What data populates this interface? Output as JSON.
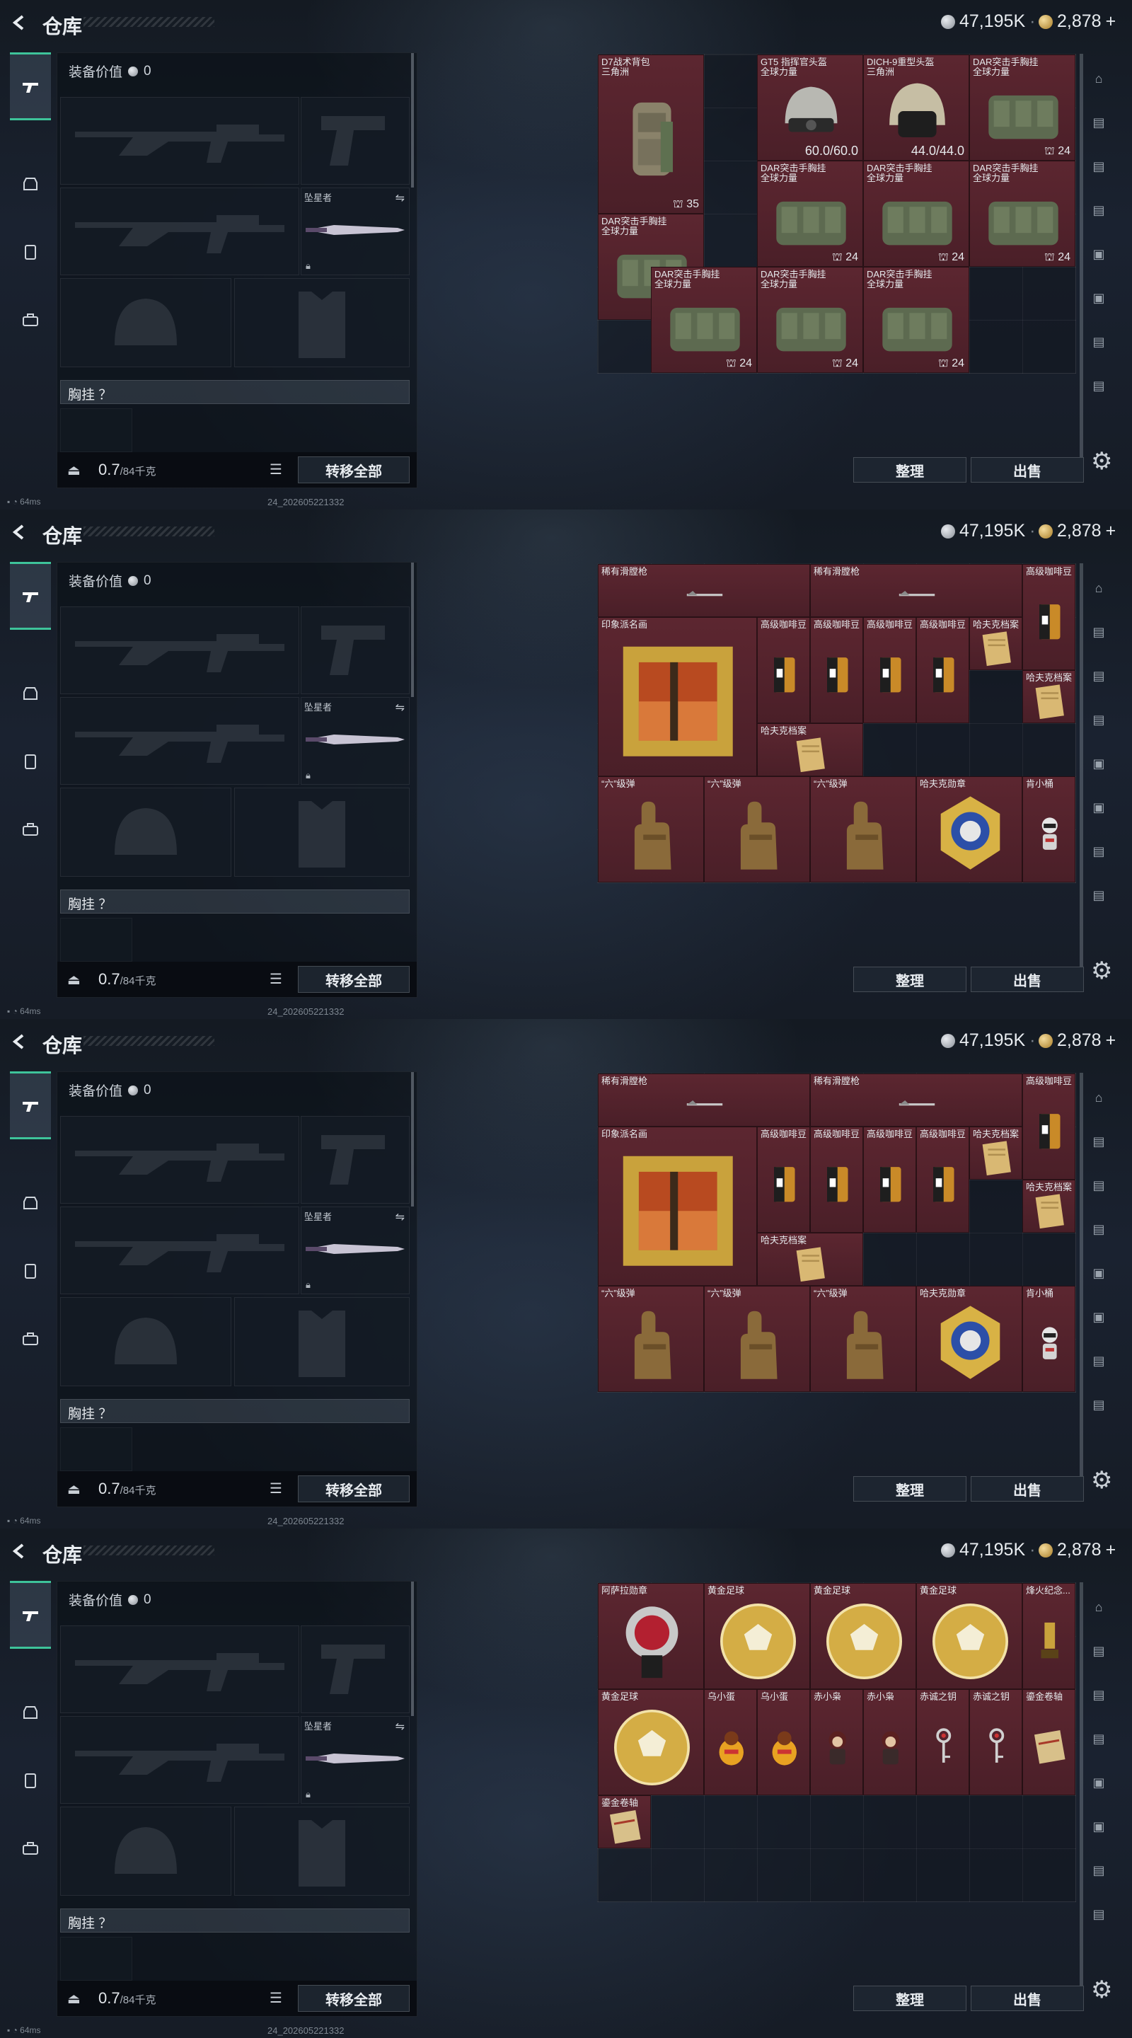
{
  "header": {
    "title": "仓库",
    "silver": "47,195K",
    "gold": "2,878",
    "plus": "+"
  },
  "loadout": {
    "gear_value_label": "装备价值",
    "gear_value": "0",
    "melee_name": "坠星者",
    "vest_label": "胸挂 ？",
    "weight": "0.7",
    "weight_max": "/84千克",
    "transfer_label": "转移全部"
  },
  "actions": {
    "sort_label": "整理",
    "sell_label": "出售"
  },
  "status": {
    "ping": "64ms",
    "build": "24_202605221332"
  },
  "panels": [
    {
      "items": [
        {
          "name": "D7战术背包\n三角洲",
          "col": 0,
          "row": 0,
          "w": 2,
          "h": 3,
          "art": "backpack",
          "count": "35",
          "red": true
        },
        {
          "name": "GT5 指挥官头盔\n全球力量",
          "col": 2,
          "row": 0,
          "w": 1,
          "h": 1,
          "art": "helmet",
          "dur": "60.0/60.0",
          "red": true
        },
        {
          "name": "DICH-9重型头盔\n三角洲",
          "col": 3,
          "row": 0,
          "w": 1,
          "h": 1,
          "art": "helmet2",
          "dur": "44.0/44.0",
          "red": true
        },
        {
          "name": "DAR突击手胸挂\n全球力量",
          "col": 4,
          "row": 0,
          "w": 1,
          "h": 1,
          "art": "vest",
          "count": "24",
          "red": true
        },
        {
          "name": "DAR突击手胸挂\n全球力量",
          "col": 2,
          "row": 1,
          "w": 1,
          "h": 1,
          "art": "vest",
          "count": "24",
          "red": true
        },
        {
          "name": "DAR突击手胸挂\n全球力量",
          "col": 3,
          "row": 1,
          "w": 1,
          "h": 1,
          "art": "vest",
          "count": "24",
          "red": true
        },
        {
          "name": "DAR突击手胸挂\n全球力量",
          "col": 4,
          "row": 1,
          "w": 1,
          "h": 1,
          "art": "vest",
          "count": "24",
          "red": true
        },
        {
          "name": "DAR突击手胸挂\n全球力量",
          "col": 0,
          "row": 2,
          "w": 1,
          "h": 1,
          "art": "vest",
          "count": "24",
          "red": true
        },
        {
          "name": "DAR突击手胸挂\n全球力量",
          "col": 1,
          "row": 2,
          "w": 1,
          "h": 1,
          "art": "vest",
          "count": "24",
          "red": true
        },
        {
          "name": "DAR突击手胸挂\n全球力量",
          "col": 2,
          "row": 2,
          "w": 1,
          "h": 1,
          "art": "vest",
          "count": "24",
          "red": true
        },
        {
          "name": "DAR突击手胸挂\n全球力量",
          "col": 3,
          "row": 2,
          "w": 1,
          "h": 1,
          "art": "vest",
          "count": "24",
          "red": true
        }
      ]
    },
    {
      "items": [
        {
          "name": "稀有滑膛枪",
          "col": 0,
          "row": 0,
          "w": 2,
          "h": 1,
          "art": "musket",
          "red": true
        },
        {
          "name": "稀有滑膛枪",
          "col": 2,
          "row": 0,
          "w": 2,
          "h": 1,
          "art": "musket",
          "red": true
        },
        {
          "name": "高级咖啡豆",
          "col": 4,
          "row": 0,
          "w": 1,
          "h": 1,
          "art": "coffee",
          "red": true
        },
        {
          "name": "印象派名画",
          "col": 0,
          "row": 1,
          "w": 2,
          "h": 2,
          "art": "painting",
          "red": true
        },
        {
          "name": "高级咖啡豆",
          "col": 2,
          "row": 1,
          "w": 1,
          "h": 1,
          "art": "coffee",
          "red": true
        },
        {
          "name": "高级咖啡豆",
          "col": 3,
          "row": 1,
          "w": 1,
          "h": 1,
          "art": "coffee",
          "red": true
        },
        {
          "name": "高级咖啡豆",
          "col": 4,
          "row": 1,
          "w": 1,
          "h": 1,
          "art": "coffee",
          "red": true
        },
        {
          "name": "高级咖啡豆",
          "col": 5,
          "row": 1,
          "w": 1,
          "h": 1,
          "art": "coffee",
          "red": true
        },
        {
          "name": "哈夫克档案",
          "col": 6,
          "row": 1,
          "w": 1,
          "h": 1,
          "art": "file",
          "red": true
        },
        {
          "name": "哈夫克档案",
          "col": 7,
          "row": 1,
          "w": 1,
          "h": 1,
          "art": "file",
          "red": true
        },
        {
          "name": "哈夫克档案",
          "col": 2,
          "row": 2,
          "w": 1,
          "h": 1,
          "art": "file",
          "red": true
        },
        {
          "name": "“六”级弹",
          "col": 0,
          "row": 3,
          "w": 1,
          "h": 1,
          "art": "hand",
          "red": true
        },
        {
          "name": "“六”级弹",
          "col": 1,
          "row": 3,
          "w": 1,
          "h": 1,
          "art": "hand",
          "red": true
        },
        {
          "name": "“六”级弹",
          "col": 2,
          "row": 3,
          "w": 1,
          "h": 1,
          "art": "hand",
          "red": true
        },
        {
          "name": "哈夫克勋章",
          "col": 3,
          "row": 3,
          "w": 1,
          "h": 1,
          "art": "medal",
          "red": true
        },
        {
          "name": "肯小桶",
          "col": 4,
          "row": 3,
          "w": 1,
          "h": 1,
          "art": "robot",
          "red": true
        }
      ]
    },
    {
      "items": [
        {
          "name": "稀有滑膛枪",
          "col": 0,
          "row": 0,
          "w": 2,
          "h": 1,
          "art": "musket",
          "red": true
        },
        {
          "name": "稀有滑膛枪",
          "col": 2,
          "row": 0,
          "w": 2,
          "h": 1,
          "art": "musket",
          "red": true
        },
        {
          "name": "高级咖啡豆",
          "col": 4,
          "row": 0,
          "w": 1,
          "h": 1,
          "art": "coffee",
          "red": true
        },
        {
          "name": "印象派名画",
          "col": 0,
          "row": 1,
          "w": 2,
          "h": 2,
          "art": "painting",
          "red": true
        },
        {
          "name": "高级咖啡豆",
          "col": 2,
          "row": 1,
          "w": 1,
          "h": 1,
          "art": "coffee",
          "red": true
        },
        {
          "name": "高级咖啡豆",
          "col": 3,
          "row": 1,
          "w": 1,
          "h": 1,
          "art": "coffee",
          "red": true
        },
        {
          "name": "高级咖啡豆",
          "col": 4,
          "row": 1,
          "w": 1,
          "h": 1,
          "art": "coffee",
          "red": true
        },
        {
          "name": "高级咖啡豆",
          "col": 5,
          "row": 1,
          "w": 1,
          "h": 1,
          "art": "coffee",
          "red": true
        },
        {
          "name": "哈夫克档案",
          "col": 6,
          "row": 1,
          "w": 1,
          "h": 1,
          "art": "file",
          "red": true
        },
        {
          "name": "哈夫克档案",
          "col": 7,
          "row": 1,
          "w": 1,
          "h": 1,
          "art": "file",
          "red": true
        },
        {
          "name": "哈夫克档案",
          "col": 2,
          "row": 2,
          "w": 1,
          "h": 1,
          "art": "file",
          "red": true
        },
        {
          "name": "“六”级弹",
          "col": 0,
          "row": 3,
          "w": 1,
          "h": 1,
          "art": "hand",
          "red": true
        },
        {
          "name": "“六”级弹",
          "col": 1,
          "row": 3,
          "w": 1,
          "h": 1,
          "art": "hand",
          "red": true
        },
        {
          "name": "“六”级弹",
          "col": 2,
          "row": 3,
          "w": 1,
          "h": 1,
          "art": "hand",
          "red": true
        },
        {
          "name": "哈夫克勋章",
          "col": 3,
          "row": 3,
          "w": 1,
          "h": 1,
          "art": "medal",
          "red": true
        },
        {
          "name": "肯小桶",
          "col": 4,
          "row": 3,
          "w": 1,
          "h": 1,
          "art": "robot",
          "red": true
        }
      ]
    },
    {
      "items": [
        {
          "name": "阿萨拉勋章",
          "col": 0,
          "row": 0,
          "w": 1,
          "h": 1,
          "art": "asala",
          "red": true
        },
        {
          "name": "黄金足球",
          "col": 1,
          "row": 0,
          "w": 1,
          "h": 1,
          "art": "ball",
          "red": true
        },
        {
          "name": "黄金足球",
          "col": 2,
          "row": 0,
          "w": 1,
          "h": 1,
          "art": "ball",
          "red": true
        },
        {
          "name": "黄金足球",
          "col": 3,
          "row": 0,
          "w": 1,
          "h": 1,
          "art": "ball",
          "red": true
        },
        {
          "name": "烽火纪念...",
          "col": 4,
          "row": 0,
          "w": 1,
          "h": 1,
          "art": "trophy",
          "red": true
        },
        {
          "name": "黄金足球",
          "col": 0,
          "row": 1,
          "w": 1,
          "h": 1,
          "art": "ball",
          "red": true
        },
        {
          "name": "乌小蛋",
          "col": 1,
          "row": 1,
          "w": 1,
          "h": 1,
          "art": "egg",
          "red": true
        },
        {
          "name": "乌小蛋",
          "col": 2,
          "row": 1,
          "w": 1,
          "h": 1,
          "art": "egg",
          "red": true
        },
        {
          "name": "赤小枭",
          "col": 3,
          "row": 1,
          "w": 1,
          "h": 1,
          "art": "hood",
          "red": true
        },
        {
          "name": "赤小枭",
          "col": 4,
          "row": 1,
          "w": 1,
          "h": 1,
          "art": "hood",
          "red": true
        },
        {
          "name": "赤诚之钥",
          "col": 5,
          "row": 1,
          "w": 1,
          "h": 1,
          "art": "key",
          "red": true
        },
        {
          "name": "赤诚之钥",
          "col": 6,
          "row": 1,
          "w": 1,
          "h": 1,
          "art": "key",
          "red": true
        },
        {
          "name": "鎏金卷轴",
          "col": 7,
          "row": 1,
          "w": 1,
          "h": 1,
          "art": "scroll",
          "red": true
        },
        {
          "name": "鎏金卷轴",
          "col": 0,
          "row": 2,
          "w": 1,
          "h": 1,
          "art": "scroll",
          "red": true
        }
      ]
    }
  ],
  "colors": {
    "accent": "#3ec49a",
    "item_bg": "#5c2630"
  }
}
